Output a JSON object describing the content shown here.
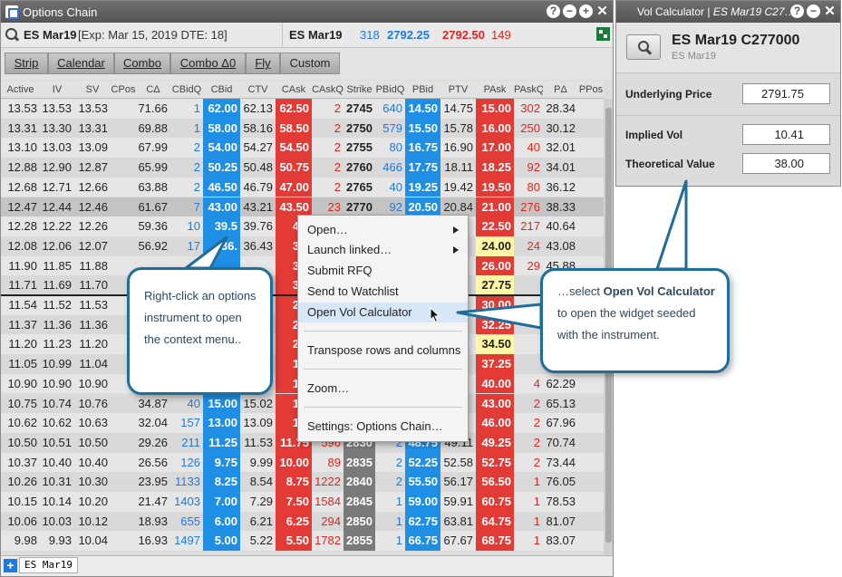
{
  "options_chain": {
    "title": "Options Chain",
    "instrument": "ES Mar19",
    "expiry_info": "[Exp: Mar 15, 2019 DTE: 18]",
    "quote": {
      "symbol": "ES Mar19",
      "bid_qty": "318",
      "bid": "2792.25",
      "ask": "2792.50",
      "ask_qty": "149"
    },
    "tabs": [
      "Strip",
      "Calendar",
      "Combo",
      "Combo Δ0",
      "Fly",
      "Custom"
    ],
    "columns": [
      "Active",
      "IV",
      "SV",
      "CPos",
      "CΔ",
      "CBidQ",
      "CBid",
      "CTV",
      "CAsk",
      "CAskQ",
      "Strike",
      "PBidQ",
      "PBid",
      "PTV",
      "PAsk",
      "PAskQ",
      "PΔ",
      "PPos"
    ],
    "rows": [
      [
        "13.53",
        "13.53",
        "13.53",
        "",
        "71.66",
        "1",
        "62.00",
        "62.13",
        "62.50",
        "2",
        "2745",
        "640",
        "14.50",
        "14.75",
        "15.00",
        "302",
        "28.34",
        ""
      ],
      [
        "13.31",
        "13.30",
        "13.31",
        "",
        "69.88",
        "1",
        "58.00",
        "58.16",
        "58.50",
        "2",
        "2750",
        "579",
        "15.50",
        "15.78",
        "16.00",
        "250",
        "30.12",
        ""
      ],
      [
        "13.10",
        "13.03",
        "13.09",
        "",
        "67.99",
        "2",
        "54.00",
        "54.27",
        "54.50",
        "2",
        "2755",
        "80",
        "16.75",
        "16.90",
        "17.00",
        "40",
        "32.01",
        ""
      ],
      [
        "12.88",
        "12.90",
        "12.87",
        "",
        "65.99",
        "2",
        "50.25",
        "50.48",
        "50.75",
        "2",
        "2760",
        "466",
        "17.75",
        "18.11",
        "18.25",
        "92",
        "34.01",
        ""
      ],
      [
        "12.68",
        "12.71",
        "12.66",
        "",
        "63.88",
        "2",
        "46.50",
        "46.79",
        "47.00",
        "2",
        "2765",
        "40",
        "19.25",
        "19.42",
        "19.50",
        "80",
        "36.12",
        ""
      ],
      [
        "12.47",
        "12.44",
        "12.46",
        "",
        "61.67",
        "7",
        "43.00",
        "43.21",
        "43.50",
        "23",
        "2770",
        "92",
        "20.50",
        "20.84",
        "21.00",
        "276",
        "38.33",
        ""
      ],
      [
        "12.28",
        "12.22",
        "12.26",
        "",
        "59.36",
        "10",
        "39.5",
        "39.76",
        "40.",
        "",
        "",
        "",
        "",
        "",
        "22.50",
        "217",
        "40.64",
        ""
      ],
      [
        "12.08",
        "12.06",
        "12.07",
        "",
        "56.92",
        "17",
        "36.",
        "36.43",
        "36.",
        "",
        "",
        "",
        "",
        "",
        "24.00",
        "24",
        "43.08",
        ""
      ],
      [
        "11.90",
        "11.85",
        "11.88",
        "",
        "",
        "",
        "",
        "",
        "33.",
        "",
        "",
        "",
        "",
        "",
        "26.00",
        "29",
        "45.88",
        ""
      ],
      [
        "11.71",
        "11.69",
        "11.70",
        "",
        "",
        "",
        "",
        "",
        "30.",
        "",
        "",
        "",
        "",
        "",
        "27.75",
        "",
        "",
        ""
      ],
      [
        "11.54",
        "11.52",
        "11.53",
        "",
        "",
        "",
        "",
        "",
        "27.",
        "",
        "",
        "",
        "",
        "",
        "30.00",
        "",
        "",
        ""
      ],
      [
        "11.37",
        "11.36",
        "11.36",
        "",
        "",
        "",
        "",
        "",
        "24.",
        "",
        "",
        "",
        "",
        "",
        "32.25",
        "",
        "",
        ""
      ],
      [
        "11.20",
        "11.23",
        "11.20",
        "",
        "",
        "",
        "",
        "",
        "22.",
        "",
        "",
        "",
        "",
        "",
        "34.50",
        "",
        "",
        ""
      ],
      [
        "11.05",
        "10.99",
        "11.04",
        "",
        "",
        "",
        "",
        "",
        "19.",
        "",
        "",
        "",
        "",
        "",
        "37.25",
        "",
        "",
        ""
      ],
      [
        "10.90",
        "10.90",
        "10.90",
        "",
        "",
        "",
        "",
        "",
        "17.",
        "",
        "",
        "",
        "",
        "",
        "40.00",
        "4",
        "62.29",
        ""
      ],
      [
        "10.75",
        "10.74",
        "10.76",
        "",
        "34.87",
        "40",
        "15.00",
        "15.02",
        "15.",
        "",
        "",
        "",
        "",
        "",
        "43.00",
        "2",
        "65.13",
        ""
      ],
      [
        "10.62",
        "10.62",
        "10.63",
        "",
        "32.04",
        "157",
        "13.00",
        "13.09",
        "13.",
        "",
        "",
        "",
        "",
        "",
        "46.00",
        "2",
        "67.96",
        ""
      ],
      [
        "10.50",
        "10.51",
        "10.50",
        "",
        "29.26",
        "211",
        "11.25",
        "11.53",
        "11.75",
        "596",
        "2830",
        "2",
        "48.75",
        "49.11",
        "49.25",
        "2",
        "70.74",
        ""
      ],
      [
        "10.37",
        "10.40",
        "10.40",
        "",
        "26.56",
        "126",
        "9.75",
        "9.99",
        "10.00",
        "89",
        "2835",
        "2",
        "52.25",
        "52.58",
        "52.75",
        "2",
        "73.44",
        ""
      ],
      [
        "10.26",
        "10.31",
        "10.30",
        "",
        "23.95",
        "1133",
        "8.25",
        "8.54",
        "8.75",
        "1222",
        "2840",
        "2",
        "55.50",
        "56.17",
        "56.50",
        "1",
        "76.05",
        ""
      ],
      [
        "10.15",
        "10.14",
        "10.20",
        "",
        "21.47",
        "1403",
        "7.00",
        "7.29",
        "7.50",
        "1584",
        "2845",
        "1",
        "59.00",
        "59.91",
        "60.75",
        "1",
        "78.53",
        ""
      ],
      [
        "10.06",
        "10.03",
        "10.12",
        "",
        "18.93",
        "655",
        "6.00",
        "6.21",
        "6.25",
        "294",
        "2850",
        "1",
        "62.75",
        "63.81",
        "64.75",
        "1",
        "81.07",
        ""
      ],
      [
        "9.98",
        "9.93",
        "10.04",
        "",
        "16.93",
        "1497",
        "5.00",
        "5.22",
        "5.50",
        "1782",
        "2855",
        "1",
        "66.75",
        "67.67",
        "68.75",
        "1",
        "83.07",
        ""
      ]
    ],
    "sheet_tab": "ES Mar19"
  },
  "context_menu": {
    "items": [
      {
        "label": "Open…",
        "submenu": true
      },
      {
        "label": "Launch linked…",
        "submenu": true
      },
      {
        "label": "Submit RFQ"
      },
      {
        "label": "Send to Watchlist"
      },
      {
        "label": "Open Vol Calculator",
        "highlighted": true
      },
      {
        "label": "Transpose rows and columns"
      },
      {
        "label": "Zoom…"
      },
      {
        "label": "Settings: Options Chain…"
      }
    ]
  },
  "vol_calc": {
    "title_prefix": "Vol Calculator | ",
    "title_inst": "ES Mar19 C27…",
    "symbol": "ES Mar19 C277000",
    "sub": "ES Mar19",
    "underlying_label": "Underlying Price",
    "underlying_value": "2791.75",
    "iv_label": "Implied Vol",
    "iv_value": "10.41",
    "tv_label": "Theoretical Value",
    "tv_value": "38.00"
  },
  "callouts": {
    "left": "Right-click an options instrument to open the context menu..",
    "right_pre": "…select ",
    "right_bold": "Open Vol Calculator",
    "right_post": " to open the widget seeded with the instrument."
  },
  "colors": {
    "bid": "#1f8fe6",
    "ask": "#e23a35",
    "callout_border": "#1e6d9a"
  }
}
